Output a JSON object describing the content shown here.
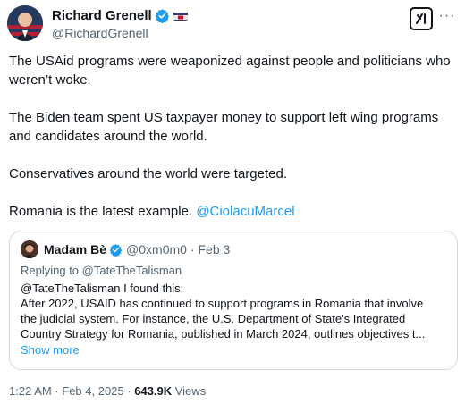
{
  "author": {
    "display_name": "Richard Grenell",
    "handle": "@RichardGrenell"
  },
  "tweet": {
    "paragraphs": [
      "The USAid programs were weaponized against people and politicians who weren’t woke.",
      "The Biden team spent US taxpayer money to support left wing programs and candidates around the world.",
      "Conservatives around the world were targeted."
    ],
    "last_line_text": "Romania is the latest example. ",
    "mention": "@CiolacuMarcel"
  },
  "quoted": {
    "display_name": "Madam Bè",
    "handle": "@0xm0m0",
    "date": "· Feb 3",
    "replying_to": "Replying to @TateTheTalisman",
    "line1": "@TateTheTalisman I found this:",
    "line2": "After 2022, USAID has continued to support programs in Romania that involve",
    "line3": "the judicial system. For instance, the U.S. Department of State's Integrated",
    "line4": "Country Strategy for Romania, published in March 2024, outlines objectives t...",
    "show_more": "Show more"
  },
  "footer": {
    "timestamp": "1:22 AM · Feb 4, 2025 · ",
    "views_count": "643.9K",
    "views_label": " Views"
  },
  "icons": {
    "verified": "verified-badge-icon",
    "flag": "flag-icon",
    "grok": "grok-icon",
    "more": "more-icon"
  },
  "colors": {
    "accent": "#1d9bf0",
    "secondary_text": "#536471",
    "border": "#cfd9de"
  }
}
